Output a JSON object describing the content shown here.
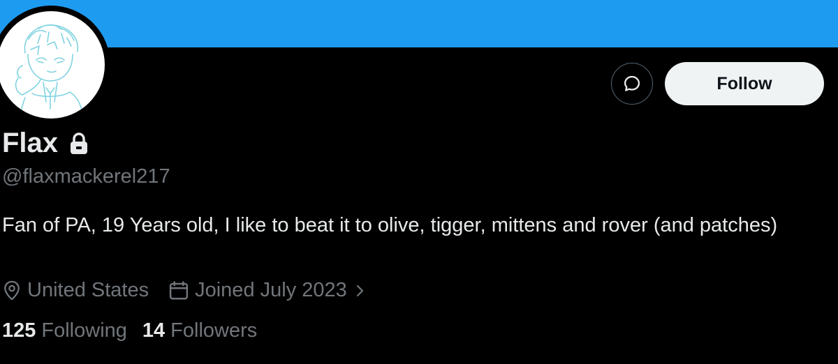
{
  "profile": {
    "display_name": "Flax",
    "handle": "@flaxmackerel217",
    "bio": "Fan of PA, 19 Years old, I like to beat it to olive, tigger, mittens and rover (and patches)",
    "location": "United States",
    "joined": "Joined July 2023",
    "following_count": "125",
    "following_label": "Following",
    "followers_count": "14",
    "followers_label": "Followers",
    "protected": true
  },
  "actions": {
    "follow_label": "Follow",
    "message_icon": "message-icon"
  },
  "colors": {
    "banner": "#1d9bf0",
    "background": "#000000",
    "primary_text": "#e7e9ea",
    "secondary_text": "#71767b",
    "follow_button_bg": "#eff3f4"
  },
  "icons": {
    "lock": "lock-icon",
    "location": "location-pin-icon",
    "calendar": "calendar-icon",
    "chevron": "chevron-right-icon"
  }
}
